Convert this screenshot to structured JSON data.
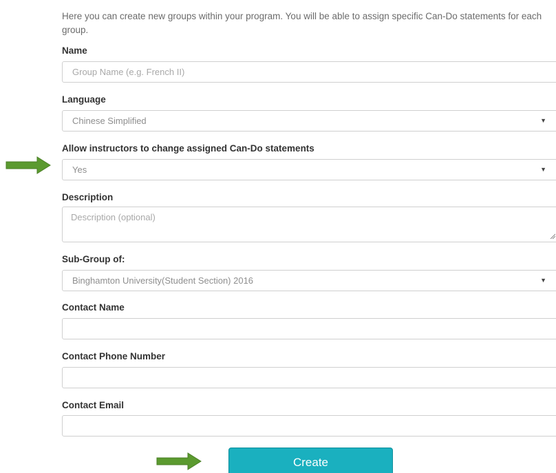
{
  "intro": "Here you can create new groups within your program. You will be able to assign specific Can-Do statements for each group.",
  "form": {
    "name": {
      "label": "Name",
      "placeholder": "Group Name (e.g. French II)",
      "value": ""
    },
    "language": {
      "label": "Language",
      "value": "Chinese Simplified"
    },
    "allow_change": {
      "label": "Allow instructors to change assigned Can-Do statements",
      "value": "Yes"
    },
    "description": {
      "label": "Description",
      "placeholder": "Description (optional)",
      "value": ""
    },
    "subgroup": {
      "label": "Sub-Group of:",
      "value": "Binghamton University(Student Section) 2016"
    },
    "contact_name": {
      "label": "Contact Name",
      "value": ""
    },
    "contact_phone": {
      "label": "Contact Phone Number",
      "value": ""
    },
    "contact_email": {
      "label": "Contact Email",
      "value": ""
    },
    "create_label": "Create",
    "caret_glyph": "▼"
  },
  "colors": {
    "accent": "#1ab0bf",
    "arrow": "#5b9a2f"
  },
  "icons": {
    "annotation_arrow": "right-arrow-icon",
    "select_caret": "caret-down-icon"
  }
}
